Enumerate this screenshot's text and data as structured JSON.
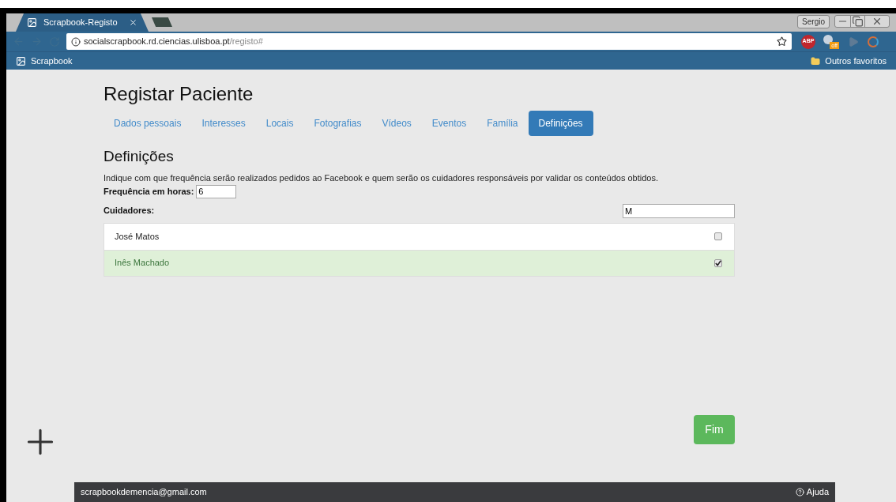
{
  "browser": {
    "tab_title": "Scrapbook-Registo",
    "user": "Sergio",
    "url_host": "socialscrapbook.rd.ciencias.ulisboa.pt",
    "url_path": "/registo#",
    "extensions": [
      {
        "kind": "abp",
        "label": "ABP"
      },
      {
        "kind": "badge",
        "label": "off"
      },
      {
        "kind": "video"
      },
      {
        "kind": "ring"
      }
    ],
    "bookmarks": [
      "Scrapbook"
    ],
    "other_bookmarks": "Outros favoritos"
  },
  "page": {
    "title": "Registar Paciente",
    "tabs": [
      {
        "label": "Dados pessoais",
        "selected": false
      },
      {
        "label": "Interesses",
        "selected": false
      },
      {
        "label": "Locais",
        "selected": false
      },
      {
        "label": "Fotografias",
        "selected": false
      },
      {
        "label": "Vídeos",
        "selected": false
      },
      {
        "label": "Eventos",
        "selected": false
      },
      {
        "label": "Família",
        "selected": false
      },
      {
        "label": "Definições",
        "selected": true
      }
    ],
    "section_title": "Definições",
    "description": "Indique com que frequência serão realizados pedidos ao Facebook e quem serão os cuidadores responsáveis por validar os conteúdos obtidos.",
    "frequency": {
      "label": "Frequência em horas:",
      "value": "6"
    },
    "caregivers": {
      "label": "Cuidadores:",
      "filter_value": "M",
      "rows": [
        {
          "name": "José Matos",
          "checked": false
        },
        {
          "name": "Inês Machado",
          "checked": true
        }
      ]
    },
    "finish_button": "Fim"
  },
  "footer": {
    "email": "scrapbookdemencia@gmail.com",
    "help": "Ajuda"
  }
}
